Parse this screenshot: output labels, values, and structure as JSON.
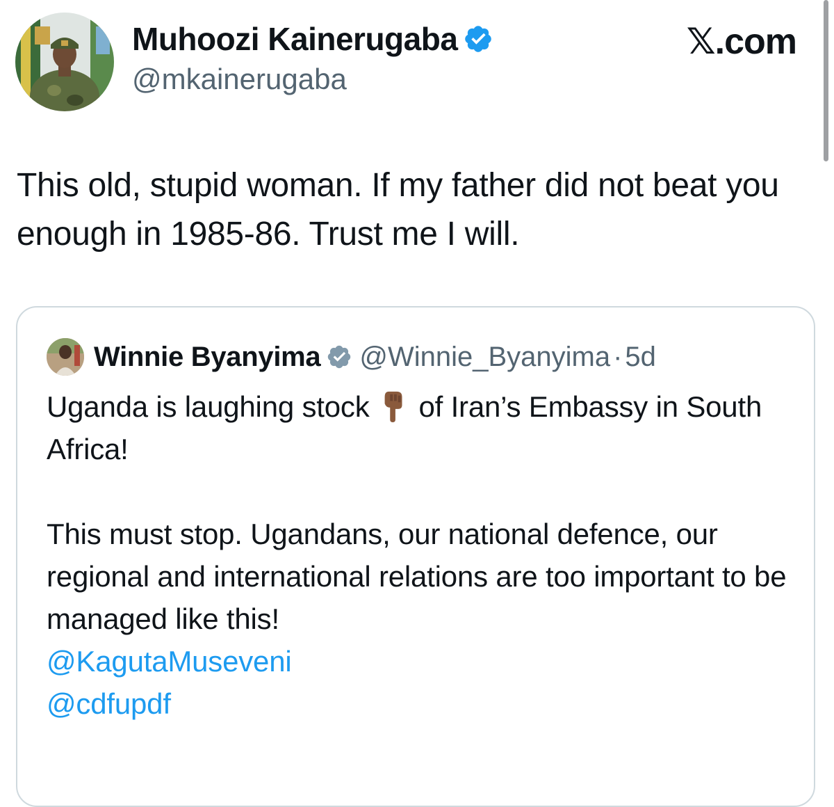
{
  "author": {
    "name": "Muhoozi Kainerugaba",
    "handle": "@mkainerugaba",
    "verified": true
  },
  "site_label": "𝕏.com",
  "tweet": {
    "text": "This old, stupid woman. If my father did not beat you enough in 1985-86. Trust me I will."
  },
  "quote": {
    "author_name": "Winnie Byanyima",
    "handle": "@Winnie_Byanyima",
    "separator": "·",
    "time": "5d",
    "text_part1": "Uganda is laughing stock",
    "emoji": "point-down-icon",
    "text_part2": "of Iran’s Embassy in South Africa!",
    "paragraph2": "This must stop. Ugandans, our national defence, our regional and international relations are too important to be managed like this!",
    "mentions": [
      "@KagutaMuseveni",
      "@cdfupdf"
    ]
  },
  "colors": {
    "verified_badge": "#1d9bf0",
    "link": "#1d9bf0",
    "muted_text": "#536471",
    "border": "#cfd9de"
  }
}
